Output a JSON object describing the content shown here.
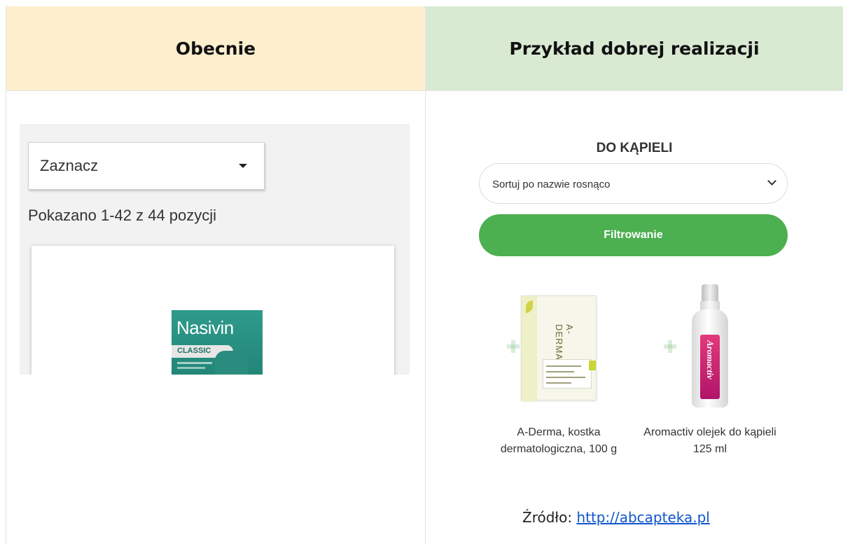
{
  "header": {
    "left_title": "Obecnie",
    "right_title": "Przykład dobrej realizacji"
  },
  "left_panel": {
    "select_label": "Zaznacz",
    "count_text": "Pokazano 1-42 z 44 pozycji",
    "product_brand": "Nasivin",
    "product_variant": "CLASSIC"
  },
  "right_panel": {
    "category_title": "DO KĄPIELI",
    "sort_select_value": "Sortuj po nazwie rosnąco",
    "filter_button": "Filtrowanie",
    "products": [
      {
        "name": "A-Derma, kostka dermatologiczna, 100 g"
      },
      {
        "name": "Aromactiv olejek do kąpieli 125 ml"
      }
    ],
    "product_image_texts": {
      "soap_brand": "A-DERMA",
      "bottle_brand": "Aromactiv"
    }
  },
  "footer": {
    "source_label": "Źródło:",
    "source_link": "http://abcapteka.pl"
  },
  "colors": {
    "header_left_bg": "#fdefce",
    "header_right_bg": "#d9ead3",
    "filter_button_bg": "#4caf50",
    "link": "#1155cc"
  }
}
